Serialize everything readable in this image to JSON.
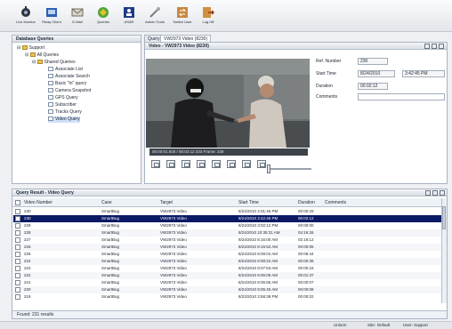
{
  "toolbar": {
    "buttons": [
      {
        "label": "Live Monitor",
        "icon": "live-monitor-icon"
      },
      {
        "label": "Relay Client",
        "icon": "relay-client-icon"
      },
      {
        "label": "E-Mail",
        "icon": "email-icon"
      },
      {
        "label": "Queries",
        "icon": "queries-icon"
      },
      {
        "label": "ASAR",
        "icon": "asar-icon"
      },
      {
        "label": "Admin Tools",
        "icon": "admin-tools-icon"
      },
      {
        "label": "Switch User",
        "icon": "switch-user-icon"
      },
      {
        "label": "Log Off",
        "icon": "log-off-icon"
      }
    ]
  },
  "db_queries": {
    "title": "Database Queries",
    "tree": [
      {
        "label": "Support",
        "level": 0,
        "type": "folder"
      },
      {
        "label": "All Queries",
        "level": 1,
        "type": "folder"
      },
      {
        "label": "Shared Queries",
        "level": 2,
        "type": "folder"
      },
      {
        "label": "Associate List",
        "level": 3,
        "type": "doc"
      },
      {
        "label": "Associate Search",
        "level": 3,
        "type": "doc"
      },
      {
        "label": "Basic \"In\" query",
        "level": 3,
        "type": "doc"
      },
      {
        "label": "Camera Snapshot",
        "level": 3,
        "type": "doc"
      },
      {
        "label": "GPS Query",
        "level": 3,
        "type": "doc"
      },
      {
        "label": "Subscriber",
        "level": 3,
        "type": "doc"
      },
      {
        "label": "Tracks Query",
        "level": 3,
        "type": "doc"
      },
      {
        "label": "Video Query",
        "level": 3,
        "type": "doc"
      }
    ]
  },
  "tabs": [
    "Query",
    "VW2973 Video (8230)"
  ],
  "video_panel": {
    "title": "Video - VW2973 Video (8230)",
    "status_text": "00:00:01.925 / 00:02:12  233 Frame: 228",
    "ref_number_label": "Ref. Number",
    "ref_number": "230",
    "start_time_label": "Start Time",
    "start_date": "8/24/2010",
    "start_clock": "3:42:45 PM",
    "duration_label": "Duration",
    "duration": "00:02:12",
    "comments_label": "Comments",
    "comments": ""
  },
  "results": {
    "title": "Query Result - Video Query",
    "columns": [
      "Video Number",
      "Case",
      "Target",
      "Start Time",
      "Duration",
      "Comments"
    ],
    "rows": [
      [
        "230",
        "SmartBug",
        "VW2973 Video",
        "8/24/2010 4:01:46 PM",
        "00:00:33",
        ""
      ],
      [
        "230",
        "SmartBug",
        "VW2973 Video",
        "8/24/2010 3:42:45 PM",
        "00:02:12",
        ""
      ],
      [
        "229",
        "SmartBug",
        "VW2973 Video",
        "8/24/2010 3:02:12 PM",
        "00:00:00",
        ""
      ],
      [
        "228",
        "SmartBug",
        "VW2973 Video",
        "8/24/2010 10:35:31 AM",
        "04:16:26",
        ""
      ],
      [
        "227",
        "SmartBug",
        "VW2973 Video",
        "8/24/2010 8:16:00 AM",
        "02:19:12",
        ""
      ],
      [
        "226",
        "SmartBug",
        "VW2973 Video",
        "8/24/2010 8:15:52 AM",
        "00:00:05",
        ""
      ],
      [
        "225",
        "SmartBug",
        "VW2973 Video",
        "8/24/2010 8:09:04 AM",
        "00:06:44",
        ""
      ],
      [
        "224",
        "SmartBug",
        "VW2973 Video",
        "8/24/2010 8:08:22 AM",
        "00:00:36",
        ""
      ],
      [
        "223",
        "SmartBug",
        "VW2973 Video",
        "8/24/2010 8:07:53 AM",
        "00:00:16",
        ""
      ],
      [
        "222",
        "SmartBug",
        "VW2973 Video",
        "8/24/2010 8:06:09 AM",
        "00:01:37",
        ""
      ],
      [
        "221",
        "SmartBug",
        "VW2973 Video",
        "8/24/2010 8:05:55 AM",
        "00:00:07",
        ""
      ],
      [
        "220",
        "SmartBug",
        "VW2973 Video",
        "8/24/2010 8:05:40 AM",
        "00:00:08",
        ""
      ],
      [
        "219",
        "SmartBug",
        "VW2973 Video",
        "8/23/2010 3:58:38 PM",
        "00:00:02",
        ""
      ]
    ],
    "found_text": "Found: 231 results"
  },
  "statusbar": {
    "unlock_label": "Unlock:",
    "site_label": "Site:",
    "site_value": "Default",
    "user_label": "User:",
    "user_value": "Support"
  },
  "colors": {
    "selected_row": "#0a1a64",
    "panel_border": "#a9b4c2",
    "toolbar_bg": "#e3e6ea"
  }
}
